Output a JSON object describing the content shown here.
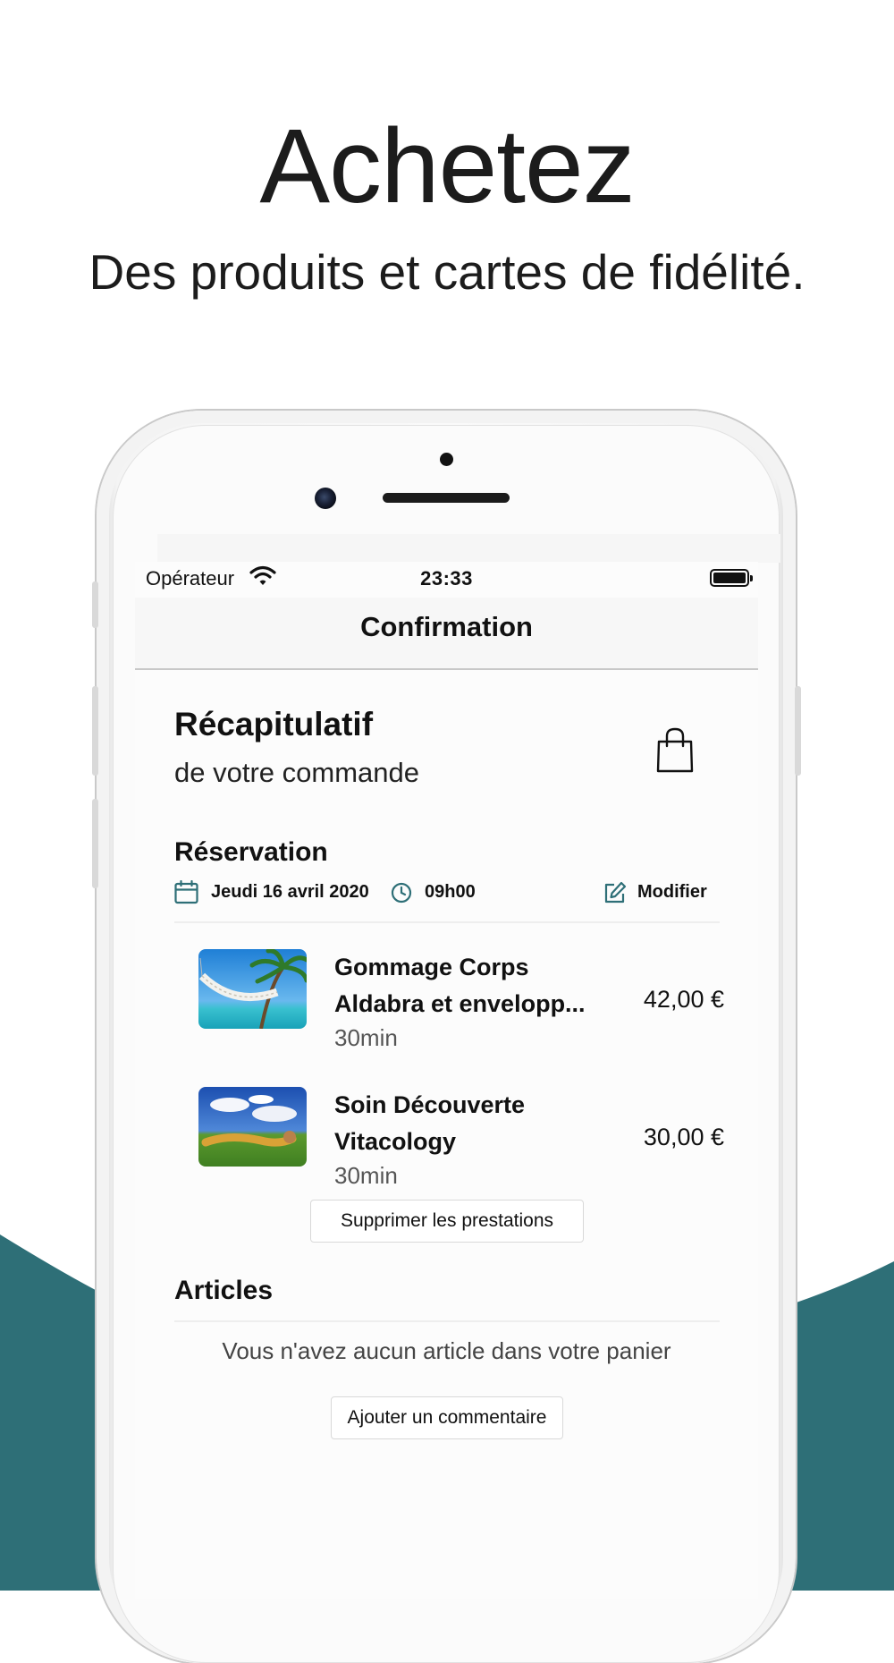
{
  "promo": {
    "headline": "Achetez",
    "subheadline": "Des produits et cartes de fidélité."
  },
  "colors": {
    "accent": "#2e6f77",
    "icon_teal": "#2e6f77"
  },
  "status_bar": {
    "carrier": "Opérateur",
    "time": "23:33"
  },
  "navbar": {
    "title": "Confirmation"
  },
  "summary": {
    "title": "Récapitulatif",
    "subtitle": "de votre commande",
    "icon": "shopping-bag-icon"
  },
  "reservation": {
    "title": "Réservation",
    "date": "Jeudi 16 avril 2020",
    "hour": "09h00",
    "modify_label": "Modifier",
    "items": [
      {
        "name": "Gommage Corps Aldabra et envelopp...",
        "duration": "30min",
        "price": "42,00 €"
      },
      {
        "name": "Soin Découverte Vitacology",
        "duration": "30min",
        "price": "30,00 €"
      }
    ],
    "delete_button": "Supprimer les prestations"
  },
  "articles": {
    "title": "Articles",
    "empty_message": "Vous n'avez aucun article dans votre panier",
    "comment_button": "Ajouter un commentaire"
  }
}
